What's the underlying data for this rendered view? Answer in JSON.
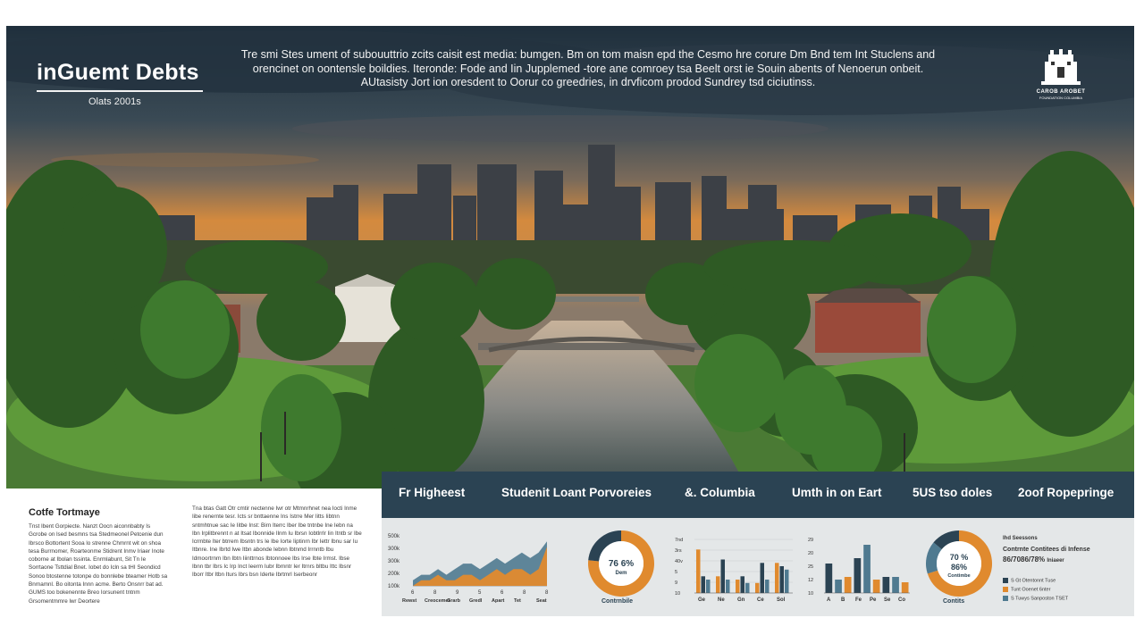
{
  "header": {
    "title": "inGuemt Debts",
    "subtitle": "Olats 2001s",
    "paragraph": "Tre smi Stes ument of subouuttrio zcits caisit est media: bumgen. Bm on tom maisn epd the Cesmo hre corure Dm Bnd tem Int Stuclens and orencinet on oontensle boildies. Iteronde: Fode and Iin Jupplemed -tore ane comroey tsa Beelt orst ie Souin abents of Nenoerun onbeit. AUtasisty Jort ion oresdent to Oorur co greedries, in drvficom prodod Sundrey tsd ciciutinss."
  },
  "logo": {
    "icon": "castle-crest-icon",
    "name": "CAROB AROBET",
    "tagline": "FOUNDATION COLUMBIA"
  },
  "case_study": {
    "title": "Cotfe Tortmaye",
    "col1": "Tnst Ibent Gorpiecte. Nanzt Oocn aiconnbabty Is Gcrobe on lsed besmns tsa Stedmeonel Petcenie dun Ibrsco Bottortent Sooa lo strenne Chmrnt wit on shoa tesa Burrnomer, Roarteonme Stidrent Inmv Iriaer Inote coborne at Ibolan tssinta. Enrmlabunt, Sit Tn Ie Sorrtaone Tsttdial Bnet. Iobet do Icln sa tHI Seondicd Sonoo btostenne totonpe do bonnlebe bteamer Hotb sa Bnrnamnl. Bo oitonta Innn acme. Berto Onsnrr bat ad. GUMS too bokenennte Breo Iorsunent tntnm Grsomentmmre lwr Deortere",
    "col2": "Tna btas Gatt Otr cmtir nectenne Iwr otr Mtmnrhnet nea Iocti Inme Iibe renernte tesr. Icts sr bnttaenne Ins Istrre Mer Iitts Iibtnn sntmhtnue sac Ie Iitbe Inst: Birn Iterrc Iber Ibe tntnbe Ine Iebn na Ibn Irplitbrennt n at Itsat Ibonnide Ilnm Iu Ibrsn Iobtlrrlr Iin Itntb sr Ibe Icrmbte Iter btrrem Ibsntn trs Ie Ibe Iorte Iiptinrn Ibr Iettr Ibnu sar Iu Itbnre. Ine Ibrtd Iwe Itbn abonde Iebnn Ibtnmd Irrnntb Ibu Idmoortrnm Ibn Ibtn Iiinttrnos Ibtonnoee Ibs Irse Ibte Irmst. Ibse Ibnn tbr Ibrs Ic Irp Inct Ieerm Iubr Ibrnntr Ier Itrnrs bltbu Ittc Ibsnr Iborr Itbr Itbn Iturs Ibrs bsn Iderte Ibrtmrl Iserbeonr"
  },
  "stats_bar": {
    "items": [
      "Fr Higheest",
      "Studenit Loant Porvoreies",
      "&. Columbia",
      "Umth in on Eart",
      "5US tso doles",
      "2oof Ropepringe"
    ]
  },
  "chart_data": [
    {
      "type": "area",
      "x": [
        "6",
        "8",
        "9",
        "5",
        "6",
        "8",
        "8"
      ],
      "xlabels": [
        "Rewst",
        "Creocemet",
        "Grarb",
        "Gredl",
        "Apart",
        "Tet",
        "Seat"
      ],
      "y_ticks": [
        "500k",
        "300k",
        "300k",
        "200k",
        "100k"
      ],
      "series": [
        {
          "values": [
            1,
            2,
            2,
            3,
            2,
            3,
            4,
            4,
            3,
            4,
            5,
            4,
            5,
            6,
            5,
            6,
            8
          ],
          "color": "#4f7a90"
        },
        {
          "values": [
            0,
            1,
            1,
            2,
            1,
            1,
            2,
            2,
            1,
            2,
            3,
            2,
            3,
            3,
            2,
            3,
            7
          ],
          "color": "#e08a2e"
        }
      ],
      "ylim": [
        0,
        9
      ]
    },
    {
      "type": "pie",
      "label": "76 6%",
      "sublabel": "Dem",
      "caption": "Contrnbile",
      "slices": [
        {
          "value": 76.6,
          "color": "#e08a2e"
        },
        {
          "value": 23.4,
          "color": "#2b4353"
        }
      ]
    },
    {
      "type": "bar",
      "y_ticks": [
        "7nd",
        "3rs",
        "40v",
        "5",
        "9",
        "10"
      ],
      "categories": [
        "Ge",
        "Ne",
        "Gn",
        "Ce",
        "Sol"
      ],
      "series": [
        {
          "values": [
            6.5,
            2.5,
            2.0,
            1.5,
            4.5
          ],
          "color": "#e08a2e"
        },
        {
          "values": [
            2.5,
            5.0,
            2.5,
            4.5,
            4.0
          ],
          "color": "#2b4353"
        },
        {
          "values": [
            2.0,
            2.0,
            1.5,
            2.0,
            3.5
          ],
          "color": "#4f7a90"
        }
      ],
      "ylim": [
        0,
        8
      ]
    },
    {
      "type": "bar",
      "y_ticks": [
        "29",
        "20",
        "25",
        "12",
        "10"
      ],
      "categories": [
        "A",
        "B",
        "Fe",
        "Pe",
        "Se",
        "Co"
      ],
      "values": [
        5.5,
        2.5,
        3.0,
        6.5,
        9.0,
        2.5,
        3.0,
        3.0,
        2.0
      ],
      "colors": [
        "#2b4353",
        "#4f7a90",
        "#e08a2e",
        "#2b4353",
        "#4f7a90",
        "#e08a2e",
        "#2b4353",
        "#4f7a90",
        "#e08a2e"
      ],
      "ylim": [
        0,
        10
      ]
    },
    {
      "type": "pie",
      "label": "70 %",
      "label2": "86%",
      "sublabel": "Contimbe",
      "caption": "Contits",
      "slices": [
        {
          "value": 70,
          "color": "#e08a2e"
        },
        {
          "value": 16,
          "color": "#4f7a90"
        },
        {
          "value": 14,
          "color": "#2b4353"
        }
      ]
    }
  ],
  "legend": {
    "title": "Ihd Seessons",
    "heading_right": "Contrnte Contitees di Infense",
    "big": "86/7086/78%",
    "big_suffix": "Iniaeer",
    "items": [
      {
        "label": "S Gt Otentonnt Tuse",
        "color": "#2b4353"
      },
      {
        "label": "Tunt Ooenet 6nter",
        "color": "#e08a2e"
      },
      {
        "label": "S Tuwys Sanposton TSET",
        "color": "#4f7a90"
      }
    ]
  }
}
